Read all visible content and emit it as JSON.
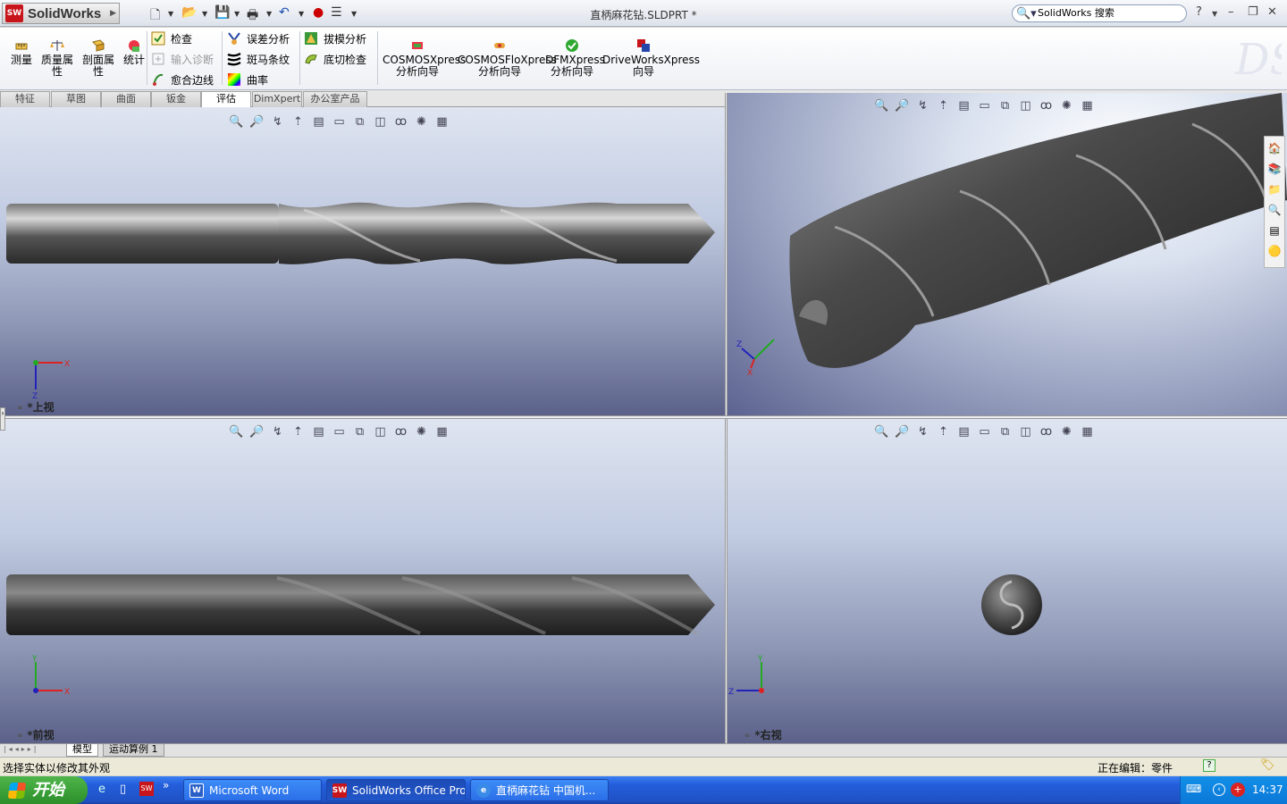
{
  "app": {
    "brand": "SolidWorks",
    "badge": "SW",
    "document_title": "直柄麻花钻.SLDPRT *"
  },
  "search": {
    "placeholder": "SolidWorks 搜索"
  },
  "window": {
    "help": "?"
  },
  "command_manager": {
    "big_buttons": [
      {
        "label1": "测量",
        "label2": ""
      },
      {
        "label1": "质量属",
        "label2": "性"
      },
      {
        "label1": "剖面属",
        "label2": "性"
      },
      {
        "label1": "统计",
        "label2": ""
      }
    ],
    "col1": [
      {
        "label": "检查",
        "disabled": false
      },
      {
        "label": "输入诊断",
        "disabled": true
      },
      {
        "label": "愈合边线",
        "disabled": false
      }
    ],
    "col2": [
      {
        "label": "误差分析"
      },
      {
        "label": "斑马条纹"
      },
      {
        "label": "曲率"
      }
    ],
    "col3": [
      {
        "label": "拔模分析"
      },
      {
        "label": "底切检查"
      }
    ],
    "xpress": [
      {
        "line1": "COSMOSXpress",
        "line2": "分析向导"
      },
      {
        "line1": "COSMOSFloXpress",
        "line2": "分析向导"
      },
      {
        "line1": "DFMXpress",
        "line2": "分析向导"
      },
      {
        "line1": "DriveWorksXpress",
        "line2": "向导"
      }
    ]
  },
  "tabs": [
    "特征",
    "草图",
    "曲面",
    "钣金",
    "评估",
    "DimXpert",
    "办公室产品"
  ],
  "active_tab": "评估",
  "viewports": {
    "top_left": {
      "label": "*上视",
      "axis1": "X",
      "axis2": "Z"
    },
    "top_right": {
      "axis1": "Z",
      "axis2": "X"
    },
    "bottom_left": {
      "label": "*前视",
      "axis1": "Y",
      "axis2": "X"
    },
    "bottom_right": {
      "label": "*右视",
      "axis1": "Y",
      "axis2": "Z"
    }
  },
  "bottom_tabs": [
    "模型",
    "运动算例 1"
  ],
  "status": {
    "left": "选择实体以修改其外观",
    "right": "正在编辑：零件",
    "help": "?"
  },
  "taskbar": {
    "start": "开始",
    "more": "»",
    "tasks": [
      {
        "label": "Microsoft Word",
        "icon": "W"
      },
      {
        "label": "SolidWorks Office Pro...",
        "icon": "SW"
      },
      {
        "label": "直柄麻花钻 中国机...",
        "icon": "e"
      }
    ],
    "clock": "14:37"
  },
  "colors": {
    "accent": "#c8151b",
    "taskbar": "#245edb",
    "start": "#2c8f2b"
  }
}
